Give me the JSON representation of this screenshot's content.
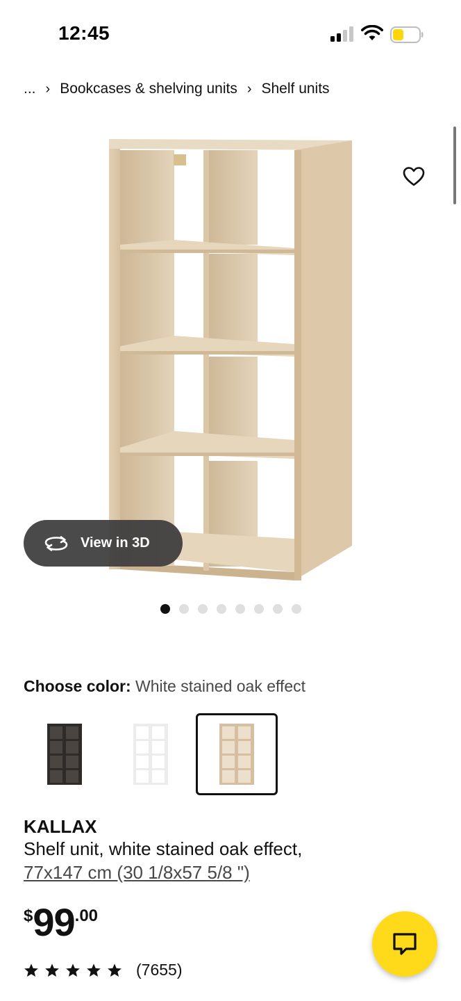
{
  "status_bar": {
    "time": "12:45",
    "signal_icon": "cellular-signal-icon",
    "wifi_icon": "wifi-icon",
    "battery_icon": "battery-icon",
    "battery_color": "#ffd60a"
  },
  "breadcrumb": {
    "items": [
      "...",
      "Bookcases & shelving units",
      "Shelf units"
    ],
    "separator_icon": "chevron-right-icon"
  },
  "product_image": {
    "favorite_icon": "heart-icon",
    "view_3d_label": "View in 3D",
    "view_3d_icon": "rotate-icon",
    "carousel_total": 8,
    "carousel_active_index": 1
  },
  "color_chooser": {
    "label": "Choose color:",
    "selected_value": "White stained oak effect",
    "swatches": [
      {
        "name": "black-brown",
        "color": "#2f2b29"
      },
      {
        "name": "white",
        "color": "#f4f4f4"
      },
      {
        "name": "white-stained-oak",
        "color": "#dcc8aa",
        "selected": true
      }
    ]
  },
  "product": {
    "name": "KALLAX",
    "description": "Shelf unit, white stained oak effect,",
    "size": "77x147 cm (30 1/8x57 5/8 \")",
    "price": {
      "currency": "$",
      "integer": "99",
      "decimal": ".00"
    },
    "rating": {
      "stars": 5,
      "count": "(7655)"
    }
  },
  "chat": {
    "icon": "chat-icon",
    "color": "#ffda1a"
  }
}
